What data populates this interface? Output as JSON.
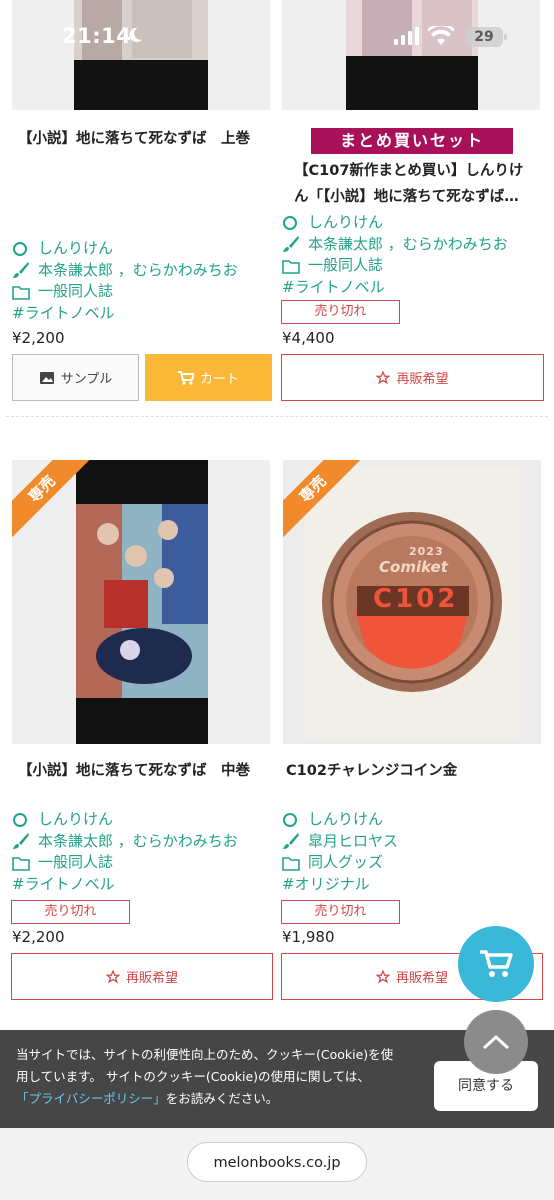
{
  "status_bar": {
    "time": "21:14",
    "battery": "29"
  },
  "products": [
    {
      "title": "【小説】地に落ちて死なずば　上巻",
      "circle": "しんりけん",
      "author": "本条謙太郎 ，むらかわみちお",
      "category": "一般同人誌",
      "genre": "#ライトノベル",
      "price": "¥2,200",
      "sample_label": "サンプル",
      "cart_label": "カート"
    },
    {
      "set_banner": "まとめ買いセット",
      "title_line1": "【C107新作まとめ買い】しんりけ",
      "title_line2": "ん「【小説】地に落ちて死なずば…",
      "circle": "しんりけん",
      "author": "本条謙太郎 ，むらかわみちお",
      "category": "一般同人誌",
      "genre": "#ライトノベル",
      "soldout": "売り切れ",
      "price": "¥4,400",
      "resale_label": "再販希望"
    },
    {
      "badge": "専売",
      "title": "【小説】地に落ちて死なずば　中巻",
      "circle": "しんりけん",
      "author": "本条謙太郎 ，むらかわみちお",
      "category": "一般同人誌",
      "genre": "#ライトノベル",
      "soldout": "売り切れ",
      "price": "¥2,200",
      "resale_label": "再販希望"
    },
    {
      "badge": "専売",
      "title": "C102チャレンジコイン金",
      "coin_text": "C102",
      "coin_brand": "Comiket",
      "coin_year": "2023",
      "circle": "しんりけん",
      "author": "皐月ヒロヤス",
      "category": "同人グッズ",
      "genre": "#オリジナル",
      "soldout": "売り切れ",
      "price": "¥1,980",
      "resale_label": "再販希望"
    }
  ],
  "cookie": {
    "line1": "当サイトでは、サイトの利便性向上のため、クッキー(Cookie)を使",
    "line2": "用しています。 サイトのクッキー(Cookie)の使用に関しては、",
    "link": "「プライバシーポリシー」",
    "line3_rest": "をお読みください。",
    "agree_label": "同意する"
  },
  "browser": {
    "url": "melonbooks.co.jp"
  },
  "colors": {
    "accent_green": "#22a38a",
    "soldout_red": "#d14848",
    "cart_orange": "#fbb838",
    "fab_blue": "#3ab8d8",
    "badge_orange": "#f08a2a"
  }
}
